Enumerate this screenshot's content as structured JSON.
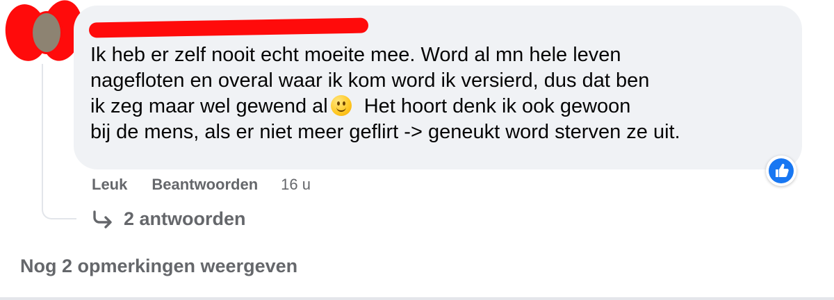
{
  "comment": {
    "author_redacted": true,
    "text_lines": [
      "Ik heb er zelf nooit echt moeite mee. Word al mn hele leven",
      "nagefloten en overal waar ik kom word ik versierd, dus dat ben",
      "ik zeg maar wel gewend al",
      "Het hoort denk ik ook gewoon",
      "bij de mens, als er niet meer geflirt -> geneukt word sterven ze uit."
    ],
    "emoji": "smiling-face-emoji",
    "reaction": "like-icon"
  },
  "actions": {
    "like_label": "Leuk",
    "reply_label": "Beantwoorden",
    "timestamp": "16 u"
  },
  "replies": {
    "label": "2 antwoorden"
  },
  "more_comments": {
    "label": "Nog 2 opmerkingen weergeven"
  },
  "colors": {
    "bubble": "#f0f2f5",
    "text": "#050505",
    "secondary_text": "#65676b",
    "like_blue": "#1877f2",
    "redaction_red": "#ff0b0b"
  }
}
